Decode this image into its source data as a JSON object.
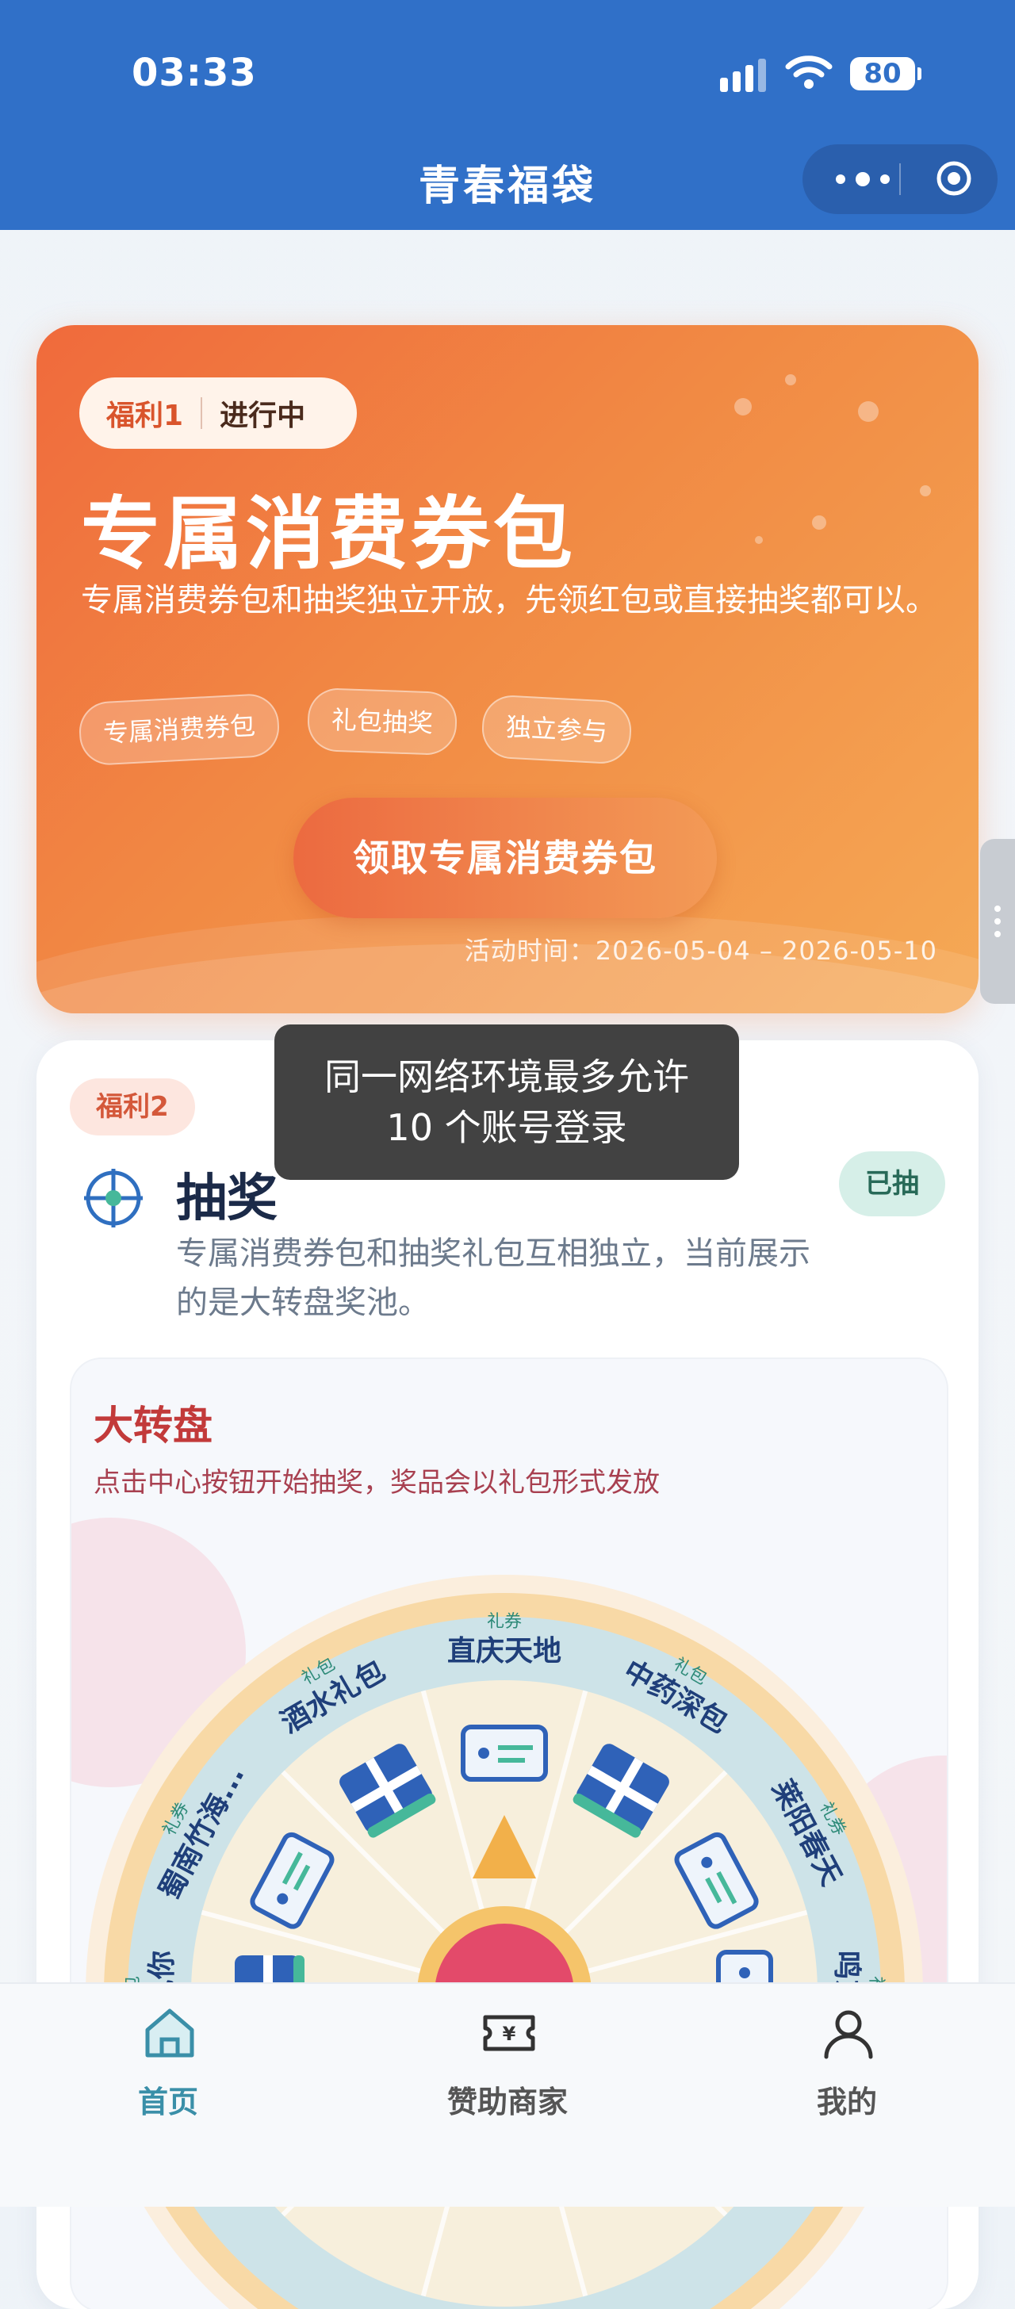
{
  "status_bar": {
    "time": "03:33",
    "battery": "80"
  },
  "nav": {
    "title": "青春福袋"
  },
  "welfare1": {
    "badge": "福利1",
    "state": "进行中",
    "title": "专属消费券包",
    "description": "专属消费券包和抽奖独立开放，先领红包或直接抽奖都可以。",
    "tags": [
      "专属消费券包",
      "礼包抽奖",
      "独立参与"
    ],
    "button_label": "领取专属消费券包",
    "activity_time": "活动时间：2026-05-04 – 2026-05-10"
  },
  "welfare2": {
    "badge": "福利2",
    "title": "抽奖",
    "status": "已抽",
    "description": "专属消费券包和抽奖礼包互相独立，当前展示的是大转盘奖池。",
    "wheel": {
      "title": "大转盘",
      "subtitle": "点击中心按钮开始抽奖，奖品会以礼包形式发放",
      "segments": [
        {
          "name": "直庆天地",
          "type": "礼券"
        },
        {
          "name": "中药深包",
          "type": "礼包"
        },
        {
          "name": "莱阳春天",
          "type": "礼券"
        },
        {
          "name": "鸣东山",
          "type": "礼券"
        },
        {
          "name": "一见你",
          "type": "礼包"
        },
        {
          "name": "蜀南竹海...",
          "type": "礼券"
        },
        {
          "name": "酒水礼包",
          "type": "礼包"
        }
      ]
    }
  },
  "toast": {
    "message": "同一网络环境最多允许 10 个账号登录"
  },
  "tabbar": {
    "tabs": [
      {
        "label": "首页"
      },
      {
        "label": "赞助商家"
      },
      {
        "label": "我的"
      }
    ]
  },
  "colors": {
    "nav_blue": "#3070c8",
    "accent_orange": "#f18a44",
    "tab_active": "#3a8fa8"
  }
}
